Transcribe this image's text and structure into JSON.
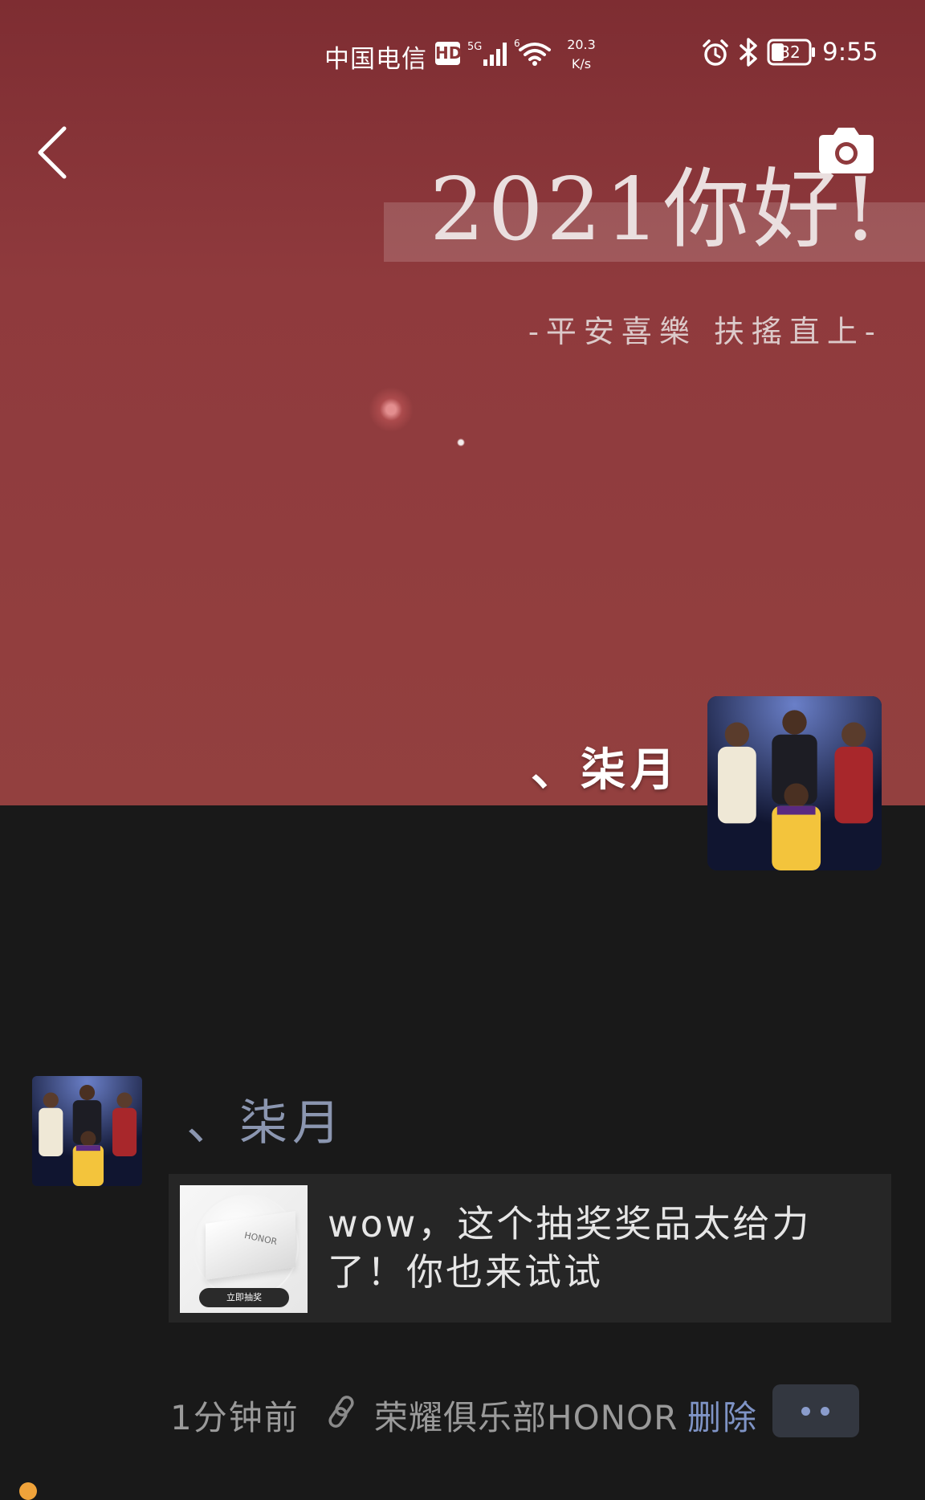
{
  "status_bar": {
    "carrier": "中国电信",
    "hd_badge": "HD",
    "network_speed_value": "20.3",
    "network_speed_unit": "K/s",
    "battery": "32",
    "time": "9:55"
  },
  "cover": {
    "headline": "2021你好!",
    "subline": "-平安喜樂 扶搖直上-"
  },
  "profile": {
    "name": "、柒月"
  },
  "post": {
    "author": "、柒月",
    "share_text": "wow，这个抽奖奖品太给力了！你也来试试",
    "thumb_brand": "HONOR",
    "thumb_cta": "立即抽奖",
    "time": "1分钟前",
    "source": "荣耀俱乐部HONOR",
    "delete_label": "删除"
  },
  "colors": {
    "cover_red": "#8f3a3d",
    "page_background": "#191919",
    "author_name": "#8b96b0",
    "delete_link": "#7f94c6",
    "card_background": "#262626"
  }
}
